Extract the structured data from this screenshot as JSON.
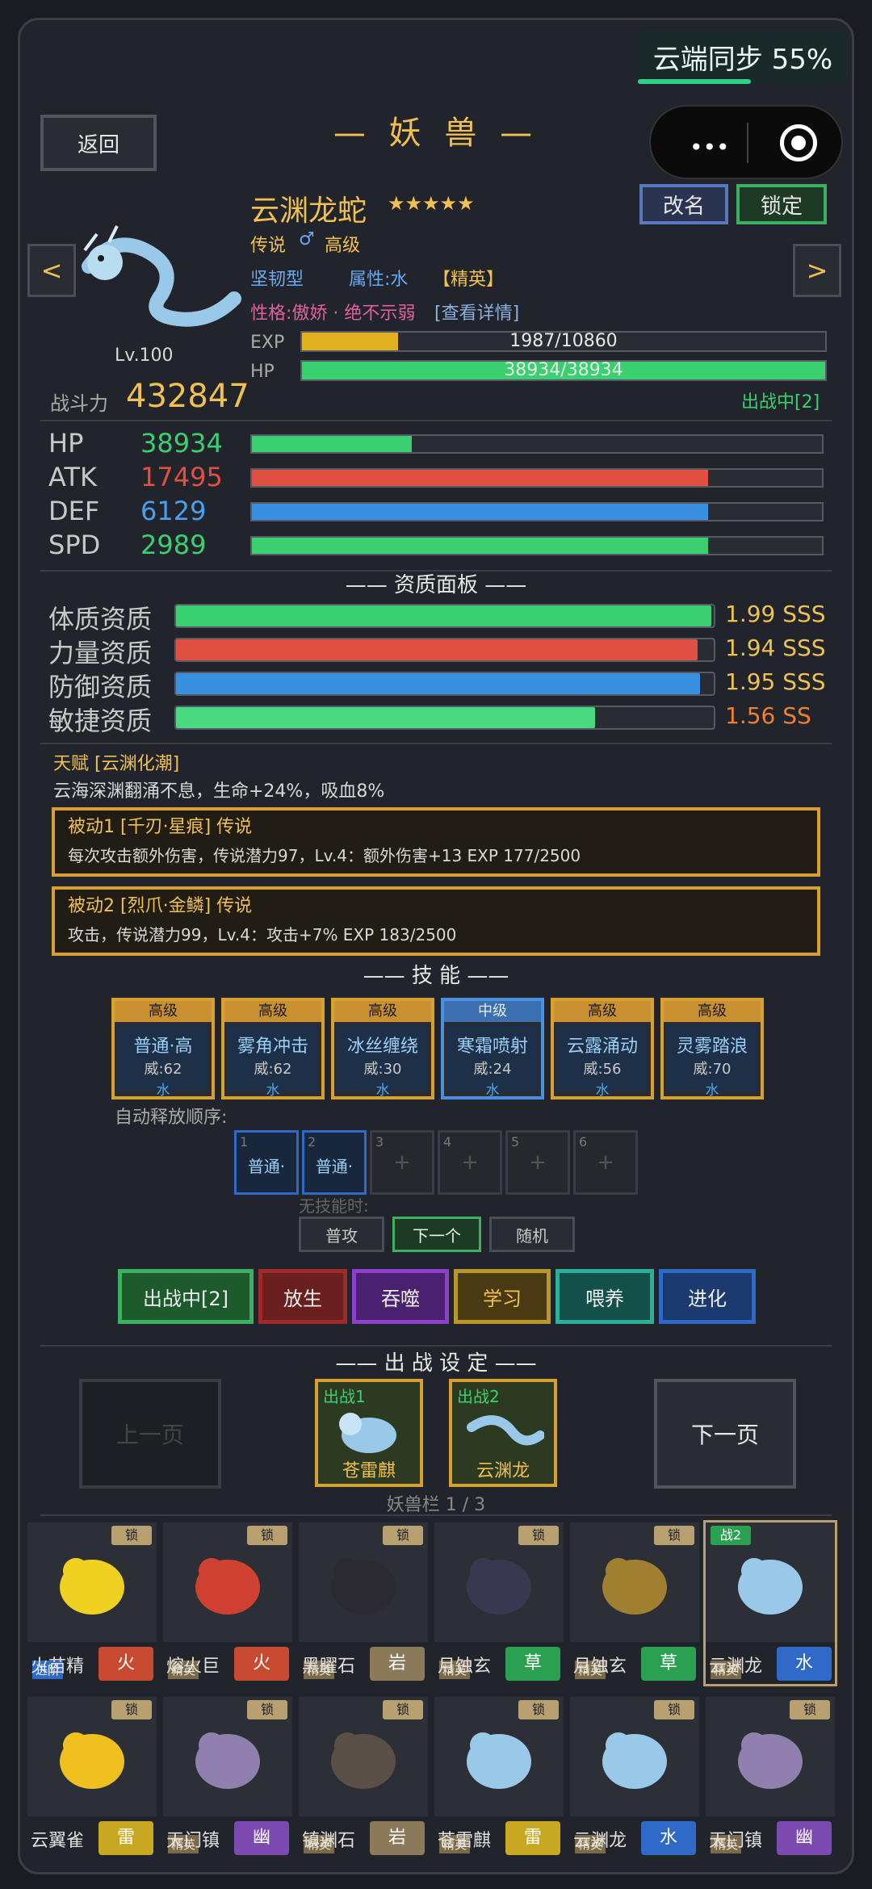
{
  "sync": {
    "label": "云端同步 55%",
    "progress": 0.55
  },
  "header": {
    "back": "返回",
    "title": "— 妖 兽 —"
  },
  "beast": {
    "name": "云渊龙蛇",
    "stars": "★★★★★",
    "rarity": "传说",
    "gender": "♂",
    "grade": "高级",
    "type": "坚韧型",
    "attr": "属性:水",
    "rank": "【精英】",
    "trait": "性格:傲娇 · 绝不示弱",
    "detail_link": "[查看详情]",
    "level": "Lv.100",
    "rename": "改名",
    "lock": "锁定",
    "exp_label": "EXP",
    "exp_text": "1987/10860",
    "exp_frac": 0.183,
    "hp_label": "HP",
    "hp_text": "38934/38934",
    "hp_frac": 1.0,
    "power_label": "战斗力",
    "power": "432847",
    "status": "出战中[2]",
    "prev": "<",
    "next": ">"
  },
  "stats": [
    {
      "label": "HP",
      "value": "38934",
      "frac": 0.28,
      "color": "#3ad070"
    },
    {
      "label": "ATK",
      "value": "17495",
      "frac": 0.8,
      "color": "#e05040"
    },
    {
      "label": "DEF",
      "value": "6129",
      "frac": 0.8,
      "color": "#3a90e0"
    },
    {
      "label": "SPD",
      "value": "2989",
      "frac": 0.8,
      "color": "#3ad070"
    }
  ],
  "aptitude": {
    "title": "—— 资质面板 ——",
    "rows": [
      {
        "label": "体质资质",
        "value": "1.99 SSS",
        "frac": 0.995,
        "color": "#3ad070",
        "vcolor": "#f0c050"
      },
      {
        "label": "力量资质",
        "value": "1.94 SSS",
        "frac": 0.97,
        "color": "#e05040",
        "vcolor": "#f0c050"
      },
      {
        "label": "防御资质",
        "value": "1.95 SSS",
        "frac": 0.975,
        "color": "#3a90e0",
        "vcolor": "#f0c050"
      },
      {
        "label": "敏捷资质",
        "value": "1.56 SS",
        "frac": 0.78,
        "color": "#4ad880",
        "vcolor": "#f08030"
      }
    ]
  },
  "talent": {
    "title": "天赋 [云渊化潮]",
    "desc": "云海深渊翻涌不息，生命+24%，吸血8%"
  },
  "passives": [
    {
      "title": "被动1 [千刃·星痕] 传说",
      "desc": "每次攻击额外伤害，传说潜力97，Lv.4：额外伤害+13  EXP 177/2500"
    },
    {
      "title": "被动2 [烈爪·金鳞] 传说",
      "desc": "攻击，传说潜力99，Lv.4：攻击+7%  EXP 183/2500"
    }
  ],
  "skills_title": "—— 技 能 ——",
  "skills": [
    {
      "grade": "高级",
      "name": "普通·高",
      "power": "威:62",
      "elem": "水"
    },
    {
      "grade": "高级",
      "name": "雾角冲击",
      "power": "威:62",
      "elem": "水"
    },
    {
      "grade": "高级",
      "name": "冰丝缠绕",
      "power": "威:30",
      "elem": "水"
    },
    {
      "grade": "中级",
      "name": "寒霜喷射",
      "power": "威:24",
      "elem": "水"
    },
    {
      "grade": "高级",
      "name": "云露涌动",
      "power": "威:56",
      "elem": "水"
    },
    {
      "grade": "高级",
      "name": "灵雾踏浪",
      "power": "威:70",
      "elem": "水"
    }
  ],
  "auto": {
    "label": "自动释放顺序:",
    "slots": [
      {
        "n": "1",
        "t": "普通·"
      },
      {
        "n": "2",
        "t": "普通·"
      },
      {
        "n": "3",
        "t": "+"
      },
      {
        "n": "4",
        "t": "+"
      },
      {
        "n": "5",
        "t": "+"
      },
      {
        "n": "6",
        "t": "+"
      }
    ],
    "noskill": "无技能时:",
    "modes": [
      "普攻",
      "下一个",
      "随机"
    ]
  },
  "actions": [
    "出战中[2]",
    "放生",
    "吞噬",
    "学习",
    "喂养",
    "进化"
  ],
  "team": {
    "title": "—— 出 战 设 定 ——",
    "prev": "上一页",
    "next": "下一页",
    "slots": [
      {
        "label": "出战1",
        "name": "苍雷麒"
      },
      {
        "label": "出战2",
        "name": "云渊龙"
      }
    ],
    "page": "妖兽栏 1 / 3"
  },
  "bag": [
    {
      "name": "火苗精",
      "elem": "火",
      "tag": "进阶",
      "lock": "锁",
      "ecolor": "#c84a30"
    },
    {
      "name": "熔火巨",
      "elem": "火",
      "tag": "精英",
      "lock": "锁",
      "ecolor": "#c84a30"
    },
    {
      "name": "黑曜石",
      "elem": "岩",
      "tag": "精英",
      "lock": "锁",
      "ecolor": "#8a7a5a"
    },
    {
      "name": "月蚀玄",
      "elem": "草",
      "tag": "精英",
      "lock": "锁",
      "ecolor": "#2aa050"
    },
    {
      "name": "月蚀玄",
      "elem": "草",
      "tag": "精英",
      "lock": "锁",
      "ecolor": "#2aa050"
    },
    {
      "name": "云渊龙",
      "elem": "水",
      "tag": "精英",
      "lock": "战2",
      "ecolor": "#2f6ac8"
    },
    {
      "name": "云翼雀",
      "elem": "雷",
      "tag": "",
      "lock": "锁",
      "ecolor": "#c8a820"
    },
    {
      "name": "天门镇",
      "elem": "幽",
      "tag": "精英",
      "lock": "锁",
      "ecolor": "#7a4ab0"
    },
    {
      "name": "镇渊石",
      "elem": "岩",
      "tag": "精英",
      "lock": "锁",
      "ecolor": "#8a7a5a"
    },
    {
      "name": "苍雷麒",
      "elem": "雷",
      "tag": "精英",
      "lock": "锁",
      "ecolor": "#c8a820"
    },
    {
      "name": "云渊龙",
      "elem": "水",
      "tag": "精英",
      "lock": "锁",
      "ecolor": "#2f6ac8"
    },
    {
      "name": "天门镇",
      "elem": "幽",
      "tag": "精英",
      "lock": "锁",
      "ecolor": "#7a4ab0"
    }
  ]
}
